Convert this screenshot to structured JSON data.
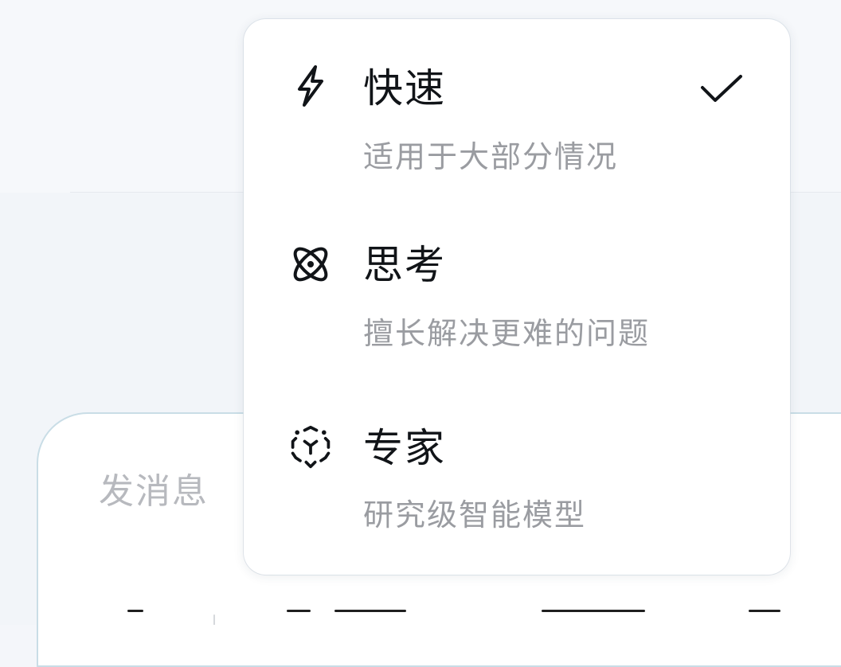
{
  "composer": {
    "placeholder": "发消息"
  },
  "menu": {
    "selected": "快速",
    "items": [
      {
        "icon": "lightning-icon",
        "title": "快速",
        "desc": "适用于大部分情况",
        "selected": true
      },
      {
        "icon": "atom-icon",
        "title": "思考",
        "desc": "擅长解决更难的问题",
        "selected": false
      },
      {
        "icon": "cube-expand-icon",
        "title": "专家",
        "desc": "研究级智能模型",
        "selected": false
      }
    ]
  },
  "colors": {
    "title": "#111418",
    "desc": "#9a9ca1",
    "placeholder": "#b7b9be",
    "composer_border": "#c9dde6",
    "background": "#f4f6fa"
  }
}
